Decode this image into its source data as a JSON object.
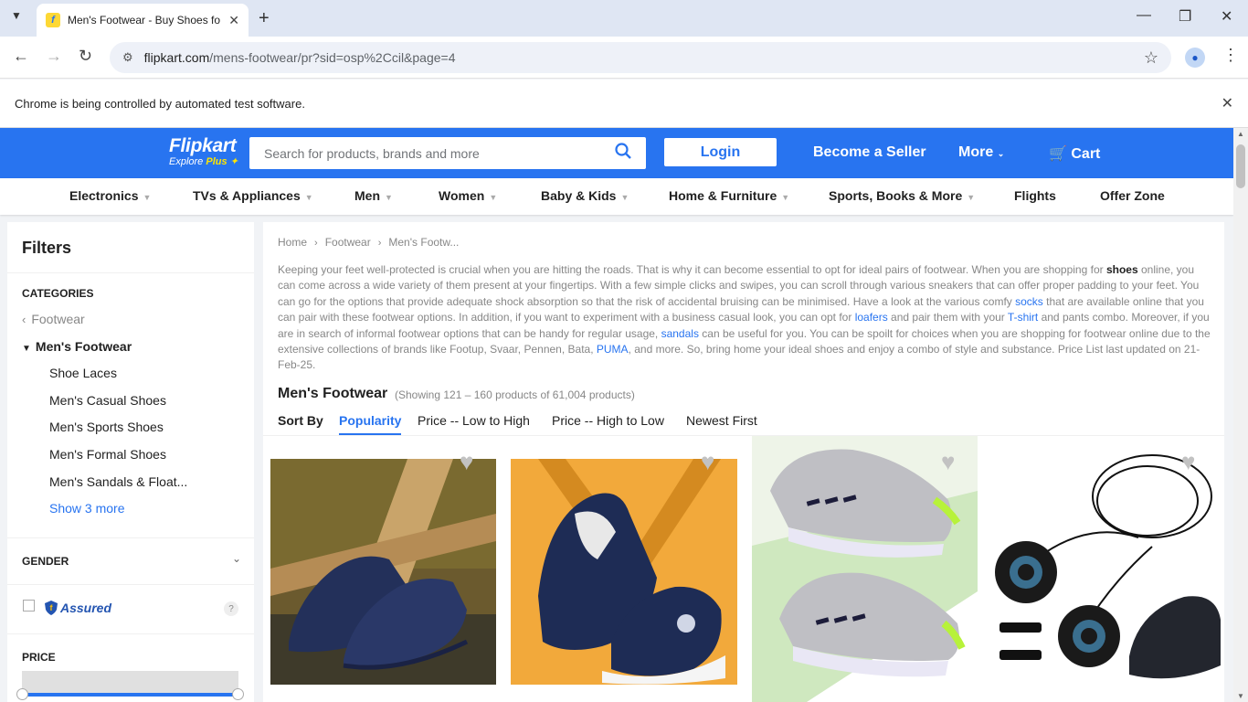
{
  "browser": {
    "tab_title": "Men's Footwear - Buy Shoes fo",
    "url_domain": "flipkart.com",
    "url_path": "/mens-footwear/pr?sid=osp%2Ccil&page=4",
    "infobar_text": "Chrome is being controlled by automated test software."
  },
  "header": {
    "logo_main": "Flipkart",
    "logo_sub": "Explore",
    "logo_plus": "Plus",
    "search_placeholder": "Search for products, brands and more",
    "login_label": "Login",
    "seller_label": "Become a Seller",
    "more_label": "More",
    "cart_label": "Cart"
  },
  "categories": [
    {
      "label": "Electronics"
    },
    {
      "label": "TVs & Appliances"
    },
    {
      "label": "Men"
    },
    {
      "label": "Women"
    },
    {
      "label": "Baby & Kids"
    },
    {
      "label": "Home & Furniture"
    },
    {
      "label": "Sports, Books & More"
    },
    {
      "label": "Flights"
    },
    {
      "label": "Offer Zone"
    }
  ],
  "filters": {
    "title": "Filters",
    "categories_title": "CATEGORIES",
    "parent_category": "Footwear",
    "current_category": "Men's Footwear",
    "subcategories": [
      "Shoe Laces",
      "Men's Casual Shoes",
      "Men's Sports Shoes",
      "Men's Formal Shoes",
      "Men's Sandals & Float..."
    ],
    "show_more": "Show 3 more",
    "gender_title": "GENDER",
    "assured_label": "Assured",
    "price_title": "PRICE"
  },
  "main": {
    "breadcrumb": [
      "Home",
      "Footwear",
      "Men's Footw..."
    ],
    "description": {
      "p1": "Keeping your feet well-protected is crucial when you are hitting the roads. That is why it can become essential to opt for ideal pairs of footwear. When you are shopping for ",
      "b1": "shoes",
      "p2": " online, you can come across a wide variety of them present at your fingertips. With a few simple clicks and swipes, you can scroll through various sneakers that can offer proper padding to your feet. You can go for the options that provide adequate shock absorption so that the risk of accidental bruising can be minimised. Have a look at the various comfy ",
      "l1": "socks",
      "p3": " that are available online that you can pair with these footwear options. In addition, if you want to experiment with a business casual look, you can opt for ",
      "l2": "loafers",
      "p4": " and pair them with your ",
      "l3": "T-shirt",
      "p5": " and pants combo. Moreover, if you are in search of informal footwear options that can be handy for regular usage, ",
      "l4": "sandals",
      "p6": " can be useful for you. You can be spoilt for choices when you are shopping for footwear online due to the extensive collections of brands like Footup, Svaar, Pennen, Bata, ",
      "l5": "PUMA",
      "p7": ", and more. So, bring home your ideal shoes and enjoy a combo of style and substance. Price List last updated on 21-Feb-25."
    },
    "title": "Men's Footwear",
    "count": "(Showing 121 – 160 products of 61,004 products)",
    "sort_label": "Sort By",
    "sort_options": [
      "Popularity",
      "Price -- Low to High",
      "Price -- High to Low",
      "Newest First"
    ],
    "products": [
      {
        "name": "navy knit slip-on sneakers"
      },
      {
        "name": "navy white slip-on shoes"
      },
      {
        "name": "grey neon running shoes"
      },
      {
        "name": "black shoes with dial laces"
      }
    ]
  },
  "colors": {
    "brand_blue": "#2874f0",
    "brand_yellow": "#ffe500"
  }
}
